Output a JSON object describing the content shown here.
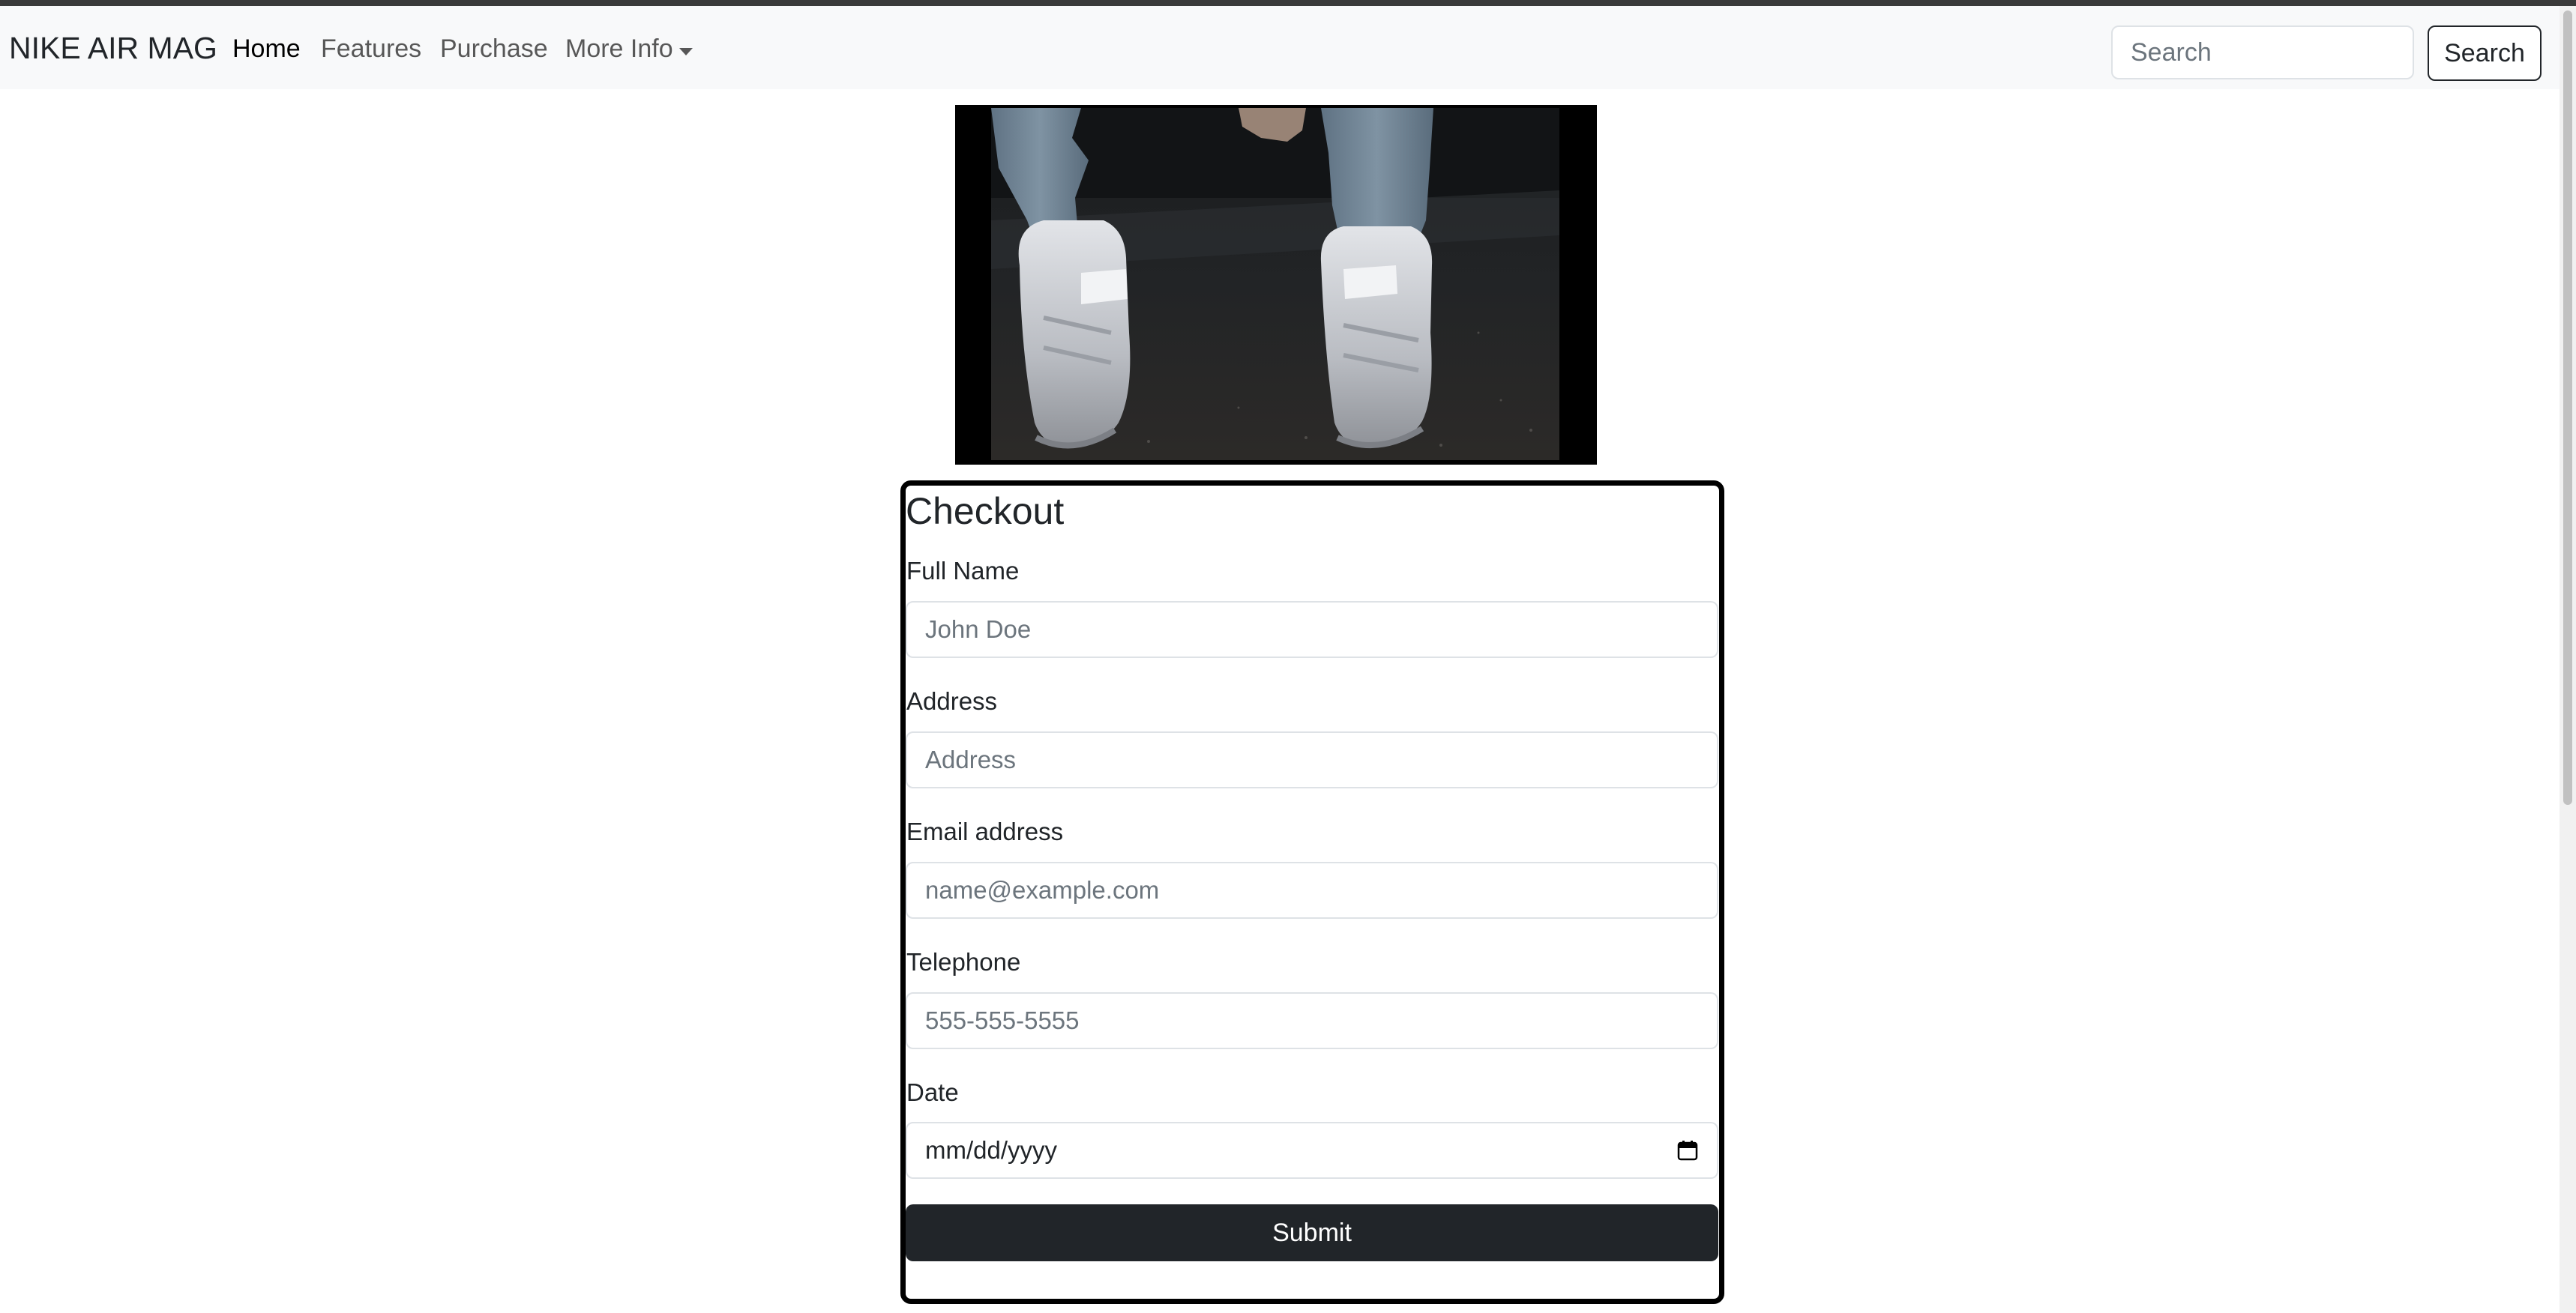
{
  "navbar": {
    "brand": "NIKE AIR MAG",
    "links": [
      {
        "label": "Home",
        "active": true
      },
      {
        "label": "Features"
      },
      {
        "label": "Purchase"
      },
      {
        "label": "More Info",
        "dropdown": true
      }
    ],
    "search_placeholder": "Search",
    "search_button": "Search"
  },
  "hero": {
    "icon": "sneakers-image"
  },
  "checkout": {
    "title": "Checkout",
    "fields": [
      {
        "label": "Full Name",
        "placeholder": "John Doe"
      },
      {
        "label": "Address",
        "placeholder": "Address"
      },
      {
        "label": "Email address",
        "placeholder": "name@example.com"
      },
      {
        "label": "Telephone",
        "placeholder": "555-555-5555"
      },
      {
        "label": "Date",
        "placeholder": "mm/dd/yyyy",
        "icon": "calendar-icon"
      }
    ],
    "submit": "Submit"
  },
  "colors": {
    "navbar_bg": "#f8f9fa",
    "button_dark": "#212529",
    "card_border": "#000000"
  }
}
